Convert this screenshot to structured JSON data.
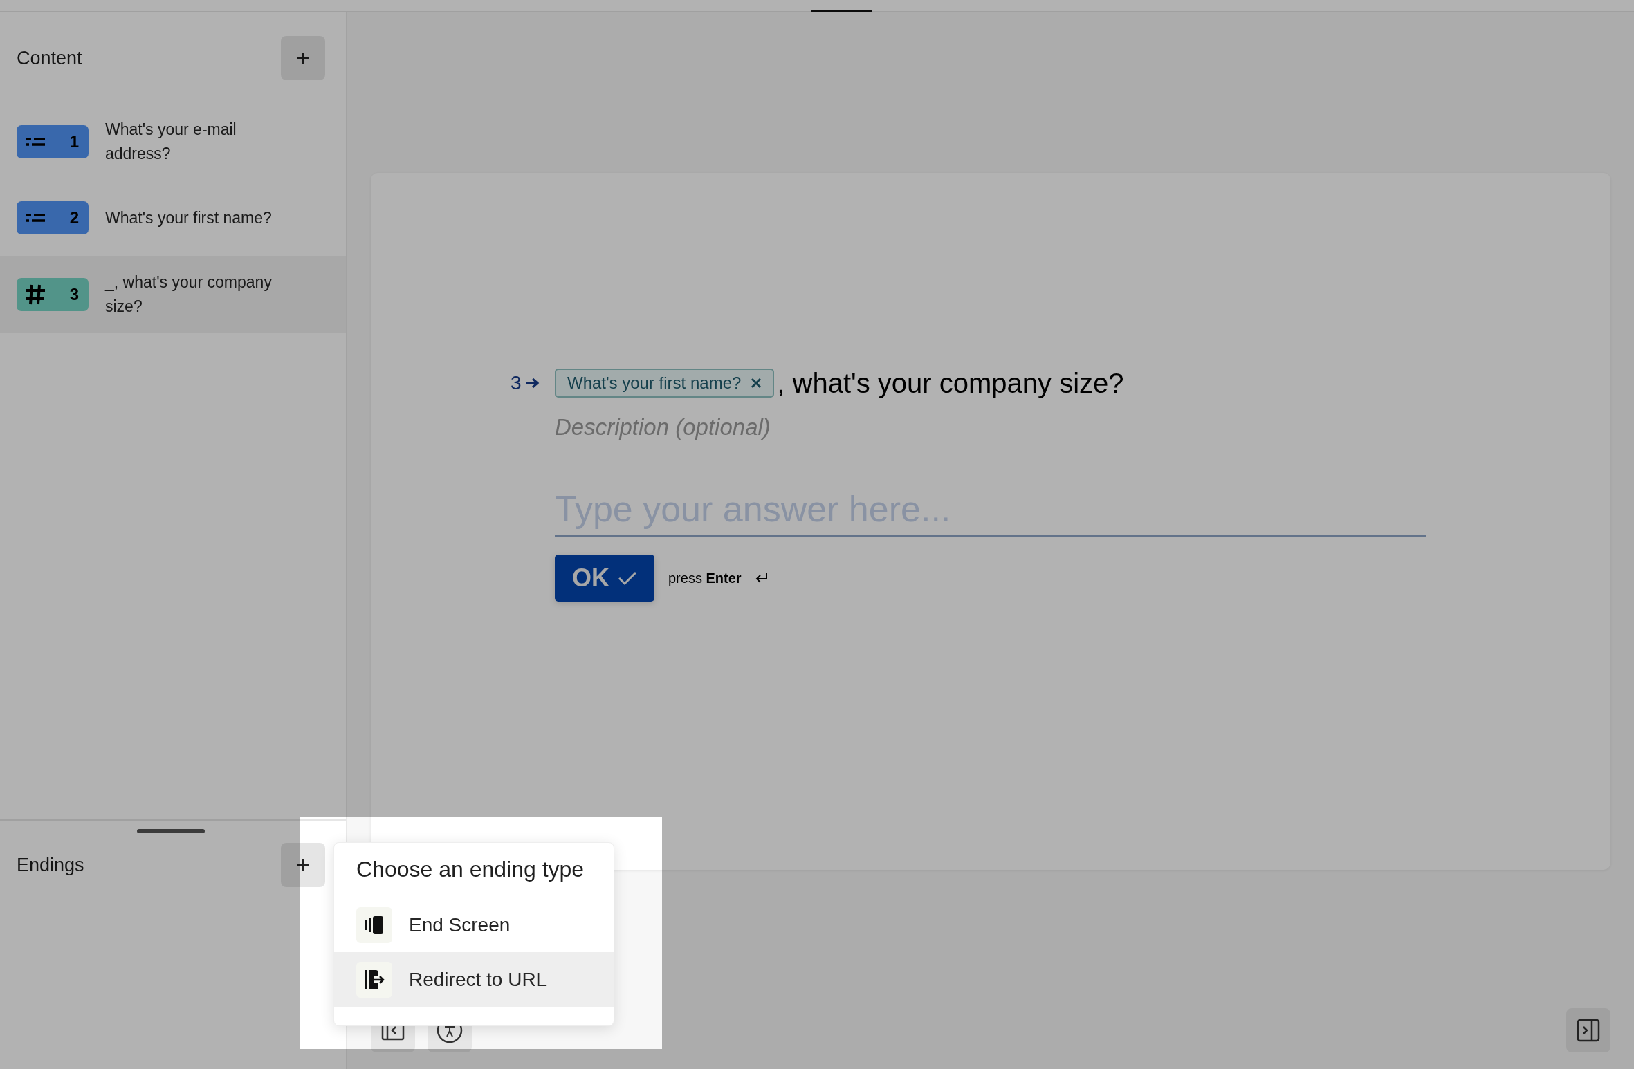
{
  "sidebar": {
    "content_title": "Content",
    "items": [
      {
        "number": "1",
        "kind": "short_text",
        "text": "What's your e-mail address?",
        "selected": false
      },
      {
        "number": "2",
        "kind": "short_text",
        "text": "What's your first name?",
        "selected": false
      },
      {
        "number": "3",
        "kind": "number",
        "text": "_, what's your company size?",
        "selected": true
      }
    ],
    "endings_title": "Endings"
  },
  "question": {
    "number": "3",
    "recall_chip": "What's your first name?",
    "title_rest": ", what's your company size?",
    "description_placeholder": "Description (optional)",
    "answer_placeholder": "Type your answer here...",
    "ok_button": "OK",
    "hint": "press **Enter**"
  },
  "ending_menu": {
    "title": "Choose an ending type",
    "items": [
      {
        "label": "End Screen",
        "kind": "end_screen",
        "selected": false
      },
      {
        "label": "Redirect to URL",
        "kind": "redirect",
        "selected": true
      }
    ]
  }
}
